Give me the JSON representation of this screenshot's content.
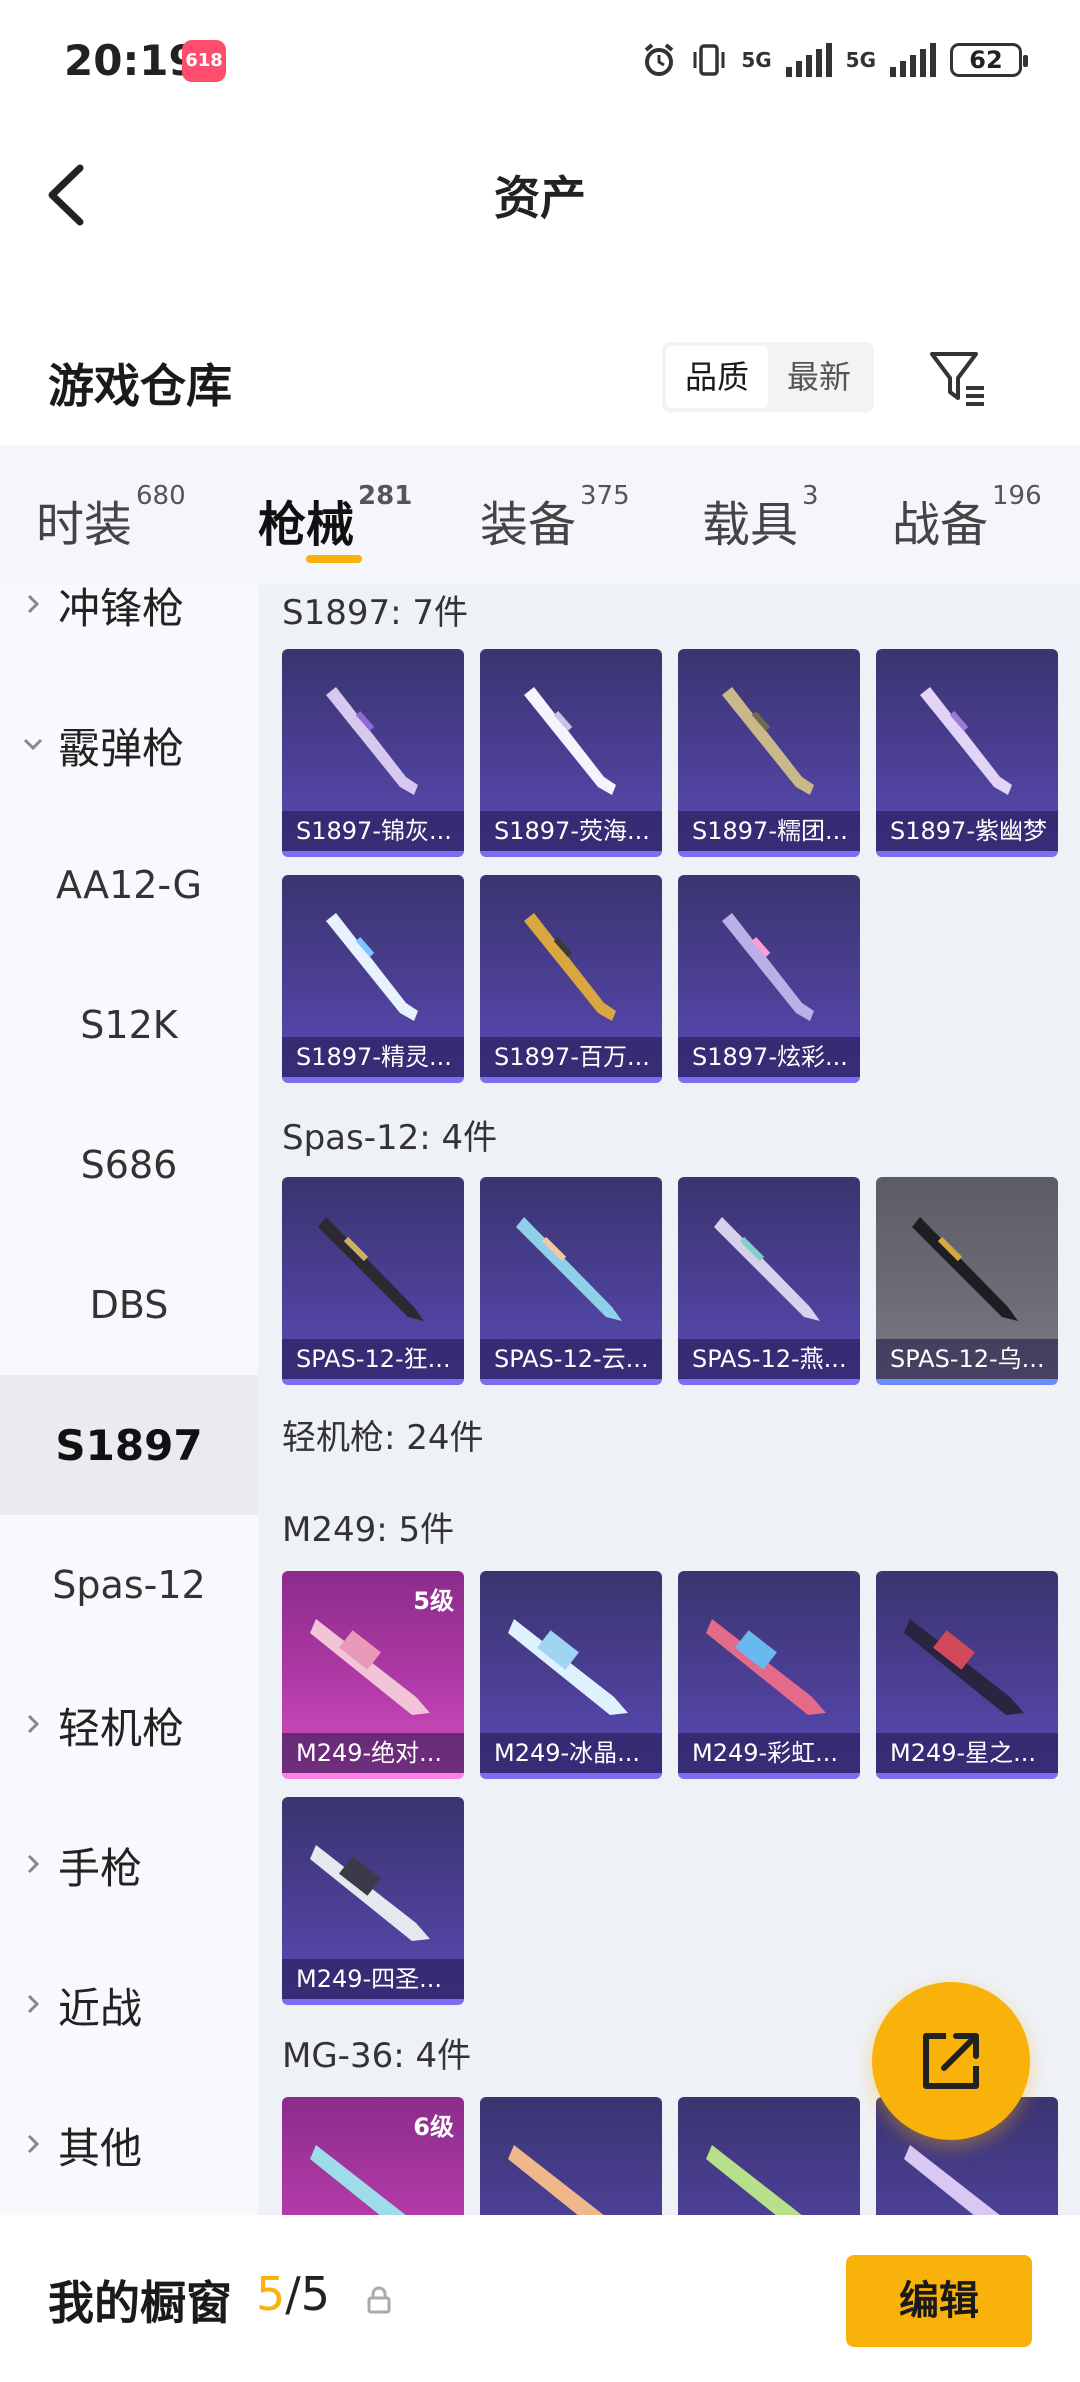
{
  "status_bar": {
    "time": "20:19",
    "badge": "618",
    "signal1": "5G",
    "signal2": "5G",
    "battery": "62"
  },
  "header": {
    "title": "资产"
  },
  "section": {
    "title": "游戏仓库",
    "sort_options": [
      "品质",
      "最新"
    ]
  },
  "category_tabs": [
    {
      "label": "时装",
      "count": "680"
    },
    {
      "label": "枪械",
      "count": "281"
    },
    {
      "label": "装备",
      "count": "375"
    },
    {
      "label": "载具",
      "count": "3"
    },
    {
      "label": "战备",
      "count": "196"
    }
  ],
  "sidebar": {
    "items": [
      {
        "label": "冲锋枪"
      },
      {
        "label": "霰弹枪"
      },
      {
        "label": "AA12-G"
      },
      {
        "label": "S12K"
      },
      {
        "label": "S686"
      },
      {
        "label": "DBS"
      },
      {
        "label": "S1897"
      },
      {
        "label": "Spas-12"
      },
      {
        "label": "轻机枪"
      },
      {
        "label": "手枪"
      },
      {
        "label": "近战"
      },
      {
        "label": "其他"
      }
    ]
  },
  "groups": [
    {
      "label": "S1897: 7件",
      "items": [
        "S1897-锦灰...",
        "S1897-荧海...",
        "S1897-糯团...",
        "S1897-紫幽梦",
        "S1897-精灵...",
        "S1897-百万...",
        "S1897-炫彩..."
      ]
    },
    {
      "label": "Spas-12: 4件",
      "items": [
        "SPAS-12-狂...",
        "SPAS-12-云...",
        "SPAS-12-燕...",
        "SPAS-12-乌..."
      ]
    },
    {
      "label": "轻机枪: 24件"
    },
    {
      "label": "M249: 5件",
      "items": [
        "M249-绝对...",
        "M249-冰晶...",
        "M249-彩虹...",
        "M249-星之...",
        "M249-四圣..."
      ],
      "level": "5级"
    },
    {
      "label": "MG-36: 4件",
      "level": "6级"
    }
  ],
  "bottom_bar": {
    "title": "我的橱窗",
    "current": "5",
    "separator": "/",
    "total": "5",
    "edit_label": "编辑"
  },
  "colors": {
    "accent": "#f9b209",
    "card_purple": "#4b3f94",
    "card_pink": "#b03aa6"
  }
}
